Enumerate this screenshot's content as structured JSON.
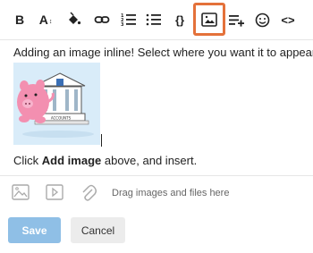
{
  "toolbar": {
    "bold_label": "B",
    "size_label": "A",
    "code_label": "{}",
    "source_label": "<>",
    "active_color": "#e4713a",
    "items": [
      "bold-icon",
      "font-size-icon",
      "fill-color-icon",
      "link-icon",
      "ordered-list-icon",
      "bullet-list-icon",
      "code-block-icon",
      "image-icon",
      "insert-row-icon",
      "emoji-icon",
      "html-source-icon"
    ]
  },
  "content": {
    "line1": "Adding an image inline! Select where you want it to appear.",
    "line2_pre": "Click ",
    "line2_bold": "Add image",
    "line2_post": " above, and insert.",
    "image_caption": "ACCOUNTS"
  },
  "attachments": {
    "drag_text": "Drag images and files here",
    "icons": [
      "picture-icon",
      "video-icon",
      "paperclip-icon"
    ]
  },
  "footer": {
    "save_label": "Save",
    "cancel_label": "Cancel",
    "save_color": "#8fbfe6",
    "cancel_color": "#ececec"
  }
}
